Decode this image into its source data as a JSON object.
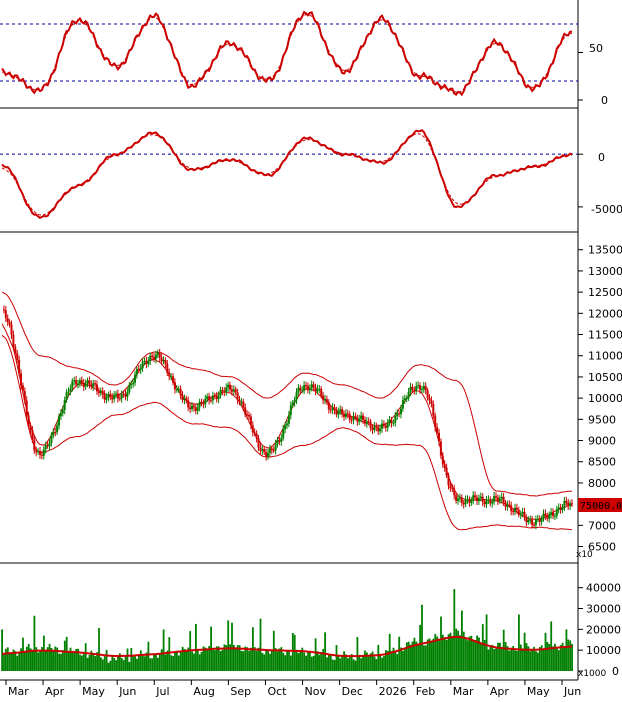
{
  "colors": {
    "price_line": "#cc0000",
    "signal_line": "#cc0000",
    "band_line": "#cc0000",
    "reference_line": "#000099",
    "candle_up": "#008000",
    "candle_down": "#cc0000",
    "volume_bar": "#008000",
    "volume_ma": "#cc0000",
    "axis": "#000000",
    "price_tag_bg": "#cc0000",
    "price_tag_text": "#000000"
  },
  "time_axis": {
    "labels": [
      "Mar",
      "Apr",
      "May",
      "Jun",
      "Jul",
      "Aug",
      "Sep",
      "Oct",
      "Nov",
      "Dec",
      "2026",
      "Feb",
      "Mar",
      "Apr",
      "May",
      "Jun"
    ]
  },
  "panels": {
    "rsi": {
      "reference_levels": [
        20,
        80
      ],
      "tick_labels": [
        "50",
        "0"
      ]
    },
    "macd": {
      "reference_levels": [
        0
      ],
      "tick_labels": [
        "0",
        "-5000"
      ]
    },
    "price": {
      "tick_labels": [
        "13500",
        "13000",
        "12500",
        "12000",
        "11500",
        "11000",
        "10500",
        "10000",
        "9500",
        "9000",
        "8500",
        "8000",
        "7500",
        "7000",
        "6500"
      ],
      "multiplier_label": "x10",
      "last_price_label": "75000.0"
    },
    "volume": {
      "tick_labels": [
        "40000",
        "30000",
        "20000",
        "10000",
        "0"
      ],
      "multiplier_label": "x1000"
    }
  },
  "chart_data": [
    {
      "type": "line",
      "title": "",
      "note": "oscillator panel (0-100 scale)",
      "x": [
        "Mar",
        "Apr",
        "May",
        "Jun",
        "Jul",
        "Aug",
        "Sep",
        "Oct",
        "Nov",
        "Dec",
        "2026",
        "Feb",
        "Mar",
        "Apr",
        "May",
        "Jun"
      ],
      "ylim": [
        0,
        100
      ],
      "series": [
        {
          "values": [
            30,
            10,
            85,
            35,
            88,
            15,
            60,
            20,
            92,
            30,
            85,
            25,
            8,
            60,
            12,
            72
          ]
        }
      ],
      "reference_levels": [
        20,
        80
      ]
    },
    {
      "type": "line",
      "title": "",
      "note": "MACD-style panel",
      "x": [
        "Mar",
        "Apr",
        "May",
        "Jun",
        "Jul",
        "Aug",
        "Sep",
        "Oct",
        "Nov",
        "Dec",
        "2026",
        "Feb",
        "Mar",
        "Apr",
        "May",
        "Jun"
      ],
      "ylim": [
        -7000,
        4000
      ],
      "series": [
        {
          "values": [
            -1000,
            -6000,
            -3000,
            0,
            2000,
            -1500,
            -500,
            -2000,
            1500,
            0,
            -800,
            2200,
            -5000,
            -2000,
            -1200,
            0
          ]
        }
      ],
      "reference_levels": [
        0
      ]
    },
    {
      "type": "line",
      "title": "",
      "note": "price panel with bands; candlesticks approximated",
      "x": [
        "Mar",
        "Apr",
        "May",
        "Jun",
        "Jul",
        "Aug",
        "Sep",
        "Oct",
        "Nov",
        "Dec",
        "2026",
        "Feb",
        "Mar",
        "Apr",
        "May",
        "Jun"
      ],
      "ylim": [
        6300,
        13800
      ],
      "series": [
        {
          "values": [
            12000,
            8700,
            10400,
            10000,
            11000,
            9800,
            10200,
            8700,
            10300,
            9600,
            9300,
            10300,
            7600,
            7600,
            7100,
            7500
          ]
        },
        {
          "values": [
            12500,
            11000,
            10700,
            10300,
            11100,
            10700,
            10500,
            10000,
            10600,
            10300,
            10000,
            10800,
            10400,
            7800,
            7700,
            7800
          ]
        },
        {
          "values": [
            11500,
            8700,
            9100,
            9600,
            9900,
            9400,
            9300,
            8600,
            8900,
            9300,
            8900,
            8900,
            6900,
            7000,
            6950,
            6900
          ]
        }
      ],
      "last_price": 75000.0
    },
    {
      "type": "bar",
      "title": "",
      "note": "volume panel (x1000)",
      "categories": [
        "Mar",
        "Apr",
        "May",
        "Jun",
        "Jul",
        "Aug",
        "Sep",
        "Oct",
        "Nov",
        "Dec",
        "2026",
        "Feb",
        "Mar",
        "Apr",
        "May",
        "Jun"
      ],
      "ylim": [
        0,
        48000
      ],
      "series": [
        {
          "values": [
            9000,
            11000,
            9000,
            6000,
            8000,
            10000,
            12000,
            10000,
            9000,
            7000,
            8000,
            14000,
            18000,
            12000,
            11000,
            13000
          ]
        },
        {
          "values": [
            8000,
            10000,
            9000,
            7000,
            8000,
            10000,
            11000,
            10000,
            9500,
            7000,
            7500,
            13000,
            17000,
            11000,
            10000,
            12000
          ]
        }
      ]
    }
  ]
}
